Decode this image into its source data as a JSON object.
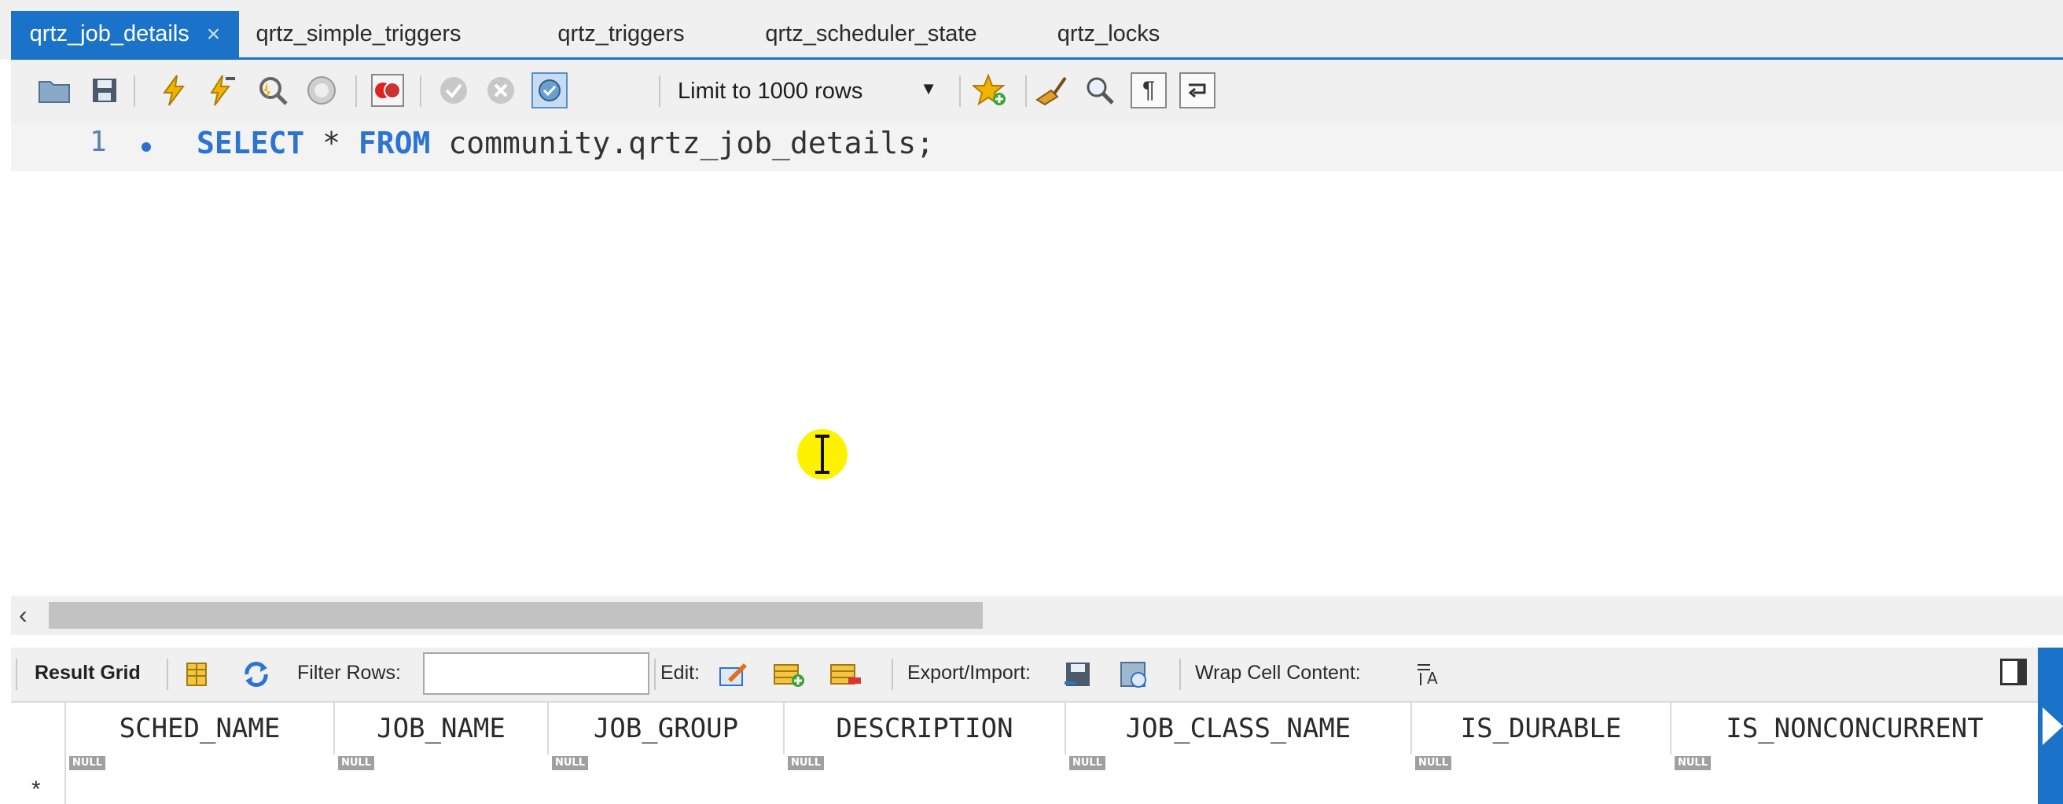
{
  "tabs": [
    {
      "label": "qrtz_job_details",
      "active": true
    },
    {
      "label": "qrtz_simple_triggers"
    },
    {
      "label": "qrtz_triggers"
    },
    {
      "label": "qrtz_scheduler_state"
    },
    {
      "label": "qrtz_locks"
    }
  ],
  "tab_close_glyph": "×",
  "toolbar": {
    "limit_label": "Limit to 1000 rows"
  },
  "editor": {
    "line_number": "1",
    "code": {
      "kw1": "SELECT",
      "star": " * ",
      "kw2": "FROM",
      "rest": " community.qrtz_job_details;"
    }
  },
  "result_toolbar": {
    "result_grid": "Result Grid",
    "filter_rows": "Filter Rows:",
    "edit": "Edit:",
    "export_import": "Export/Import:",
    "wrap_cell": "Wrap Cell Content:"
  },
  "grid": {
    "columns": [
      "SCHED_NAME",
      "JOB_NAME",
      "JOB_GROUP",
      "DESCRIPTION",
      "JOB_CLASS_NAME",
      "IS_DURABLE",
      "IS_NONCONCURRENT"
    ],
    "null_label": "NULL",
    "row_marker": "*"
  },
  "colors": {
    "accent": "#1a73c8",
    "keyword": "#2c73d2",
    "cursor_highlight": "#fff200"
  }
}
